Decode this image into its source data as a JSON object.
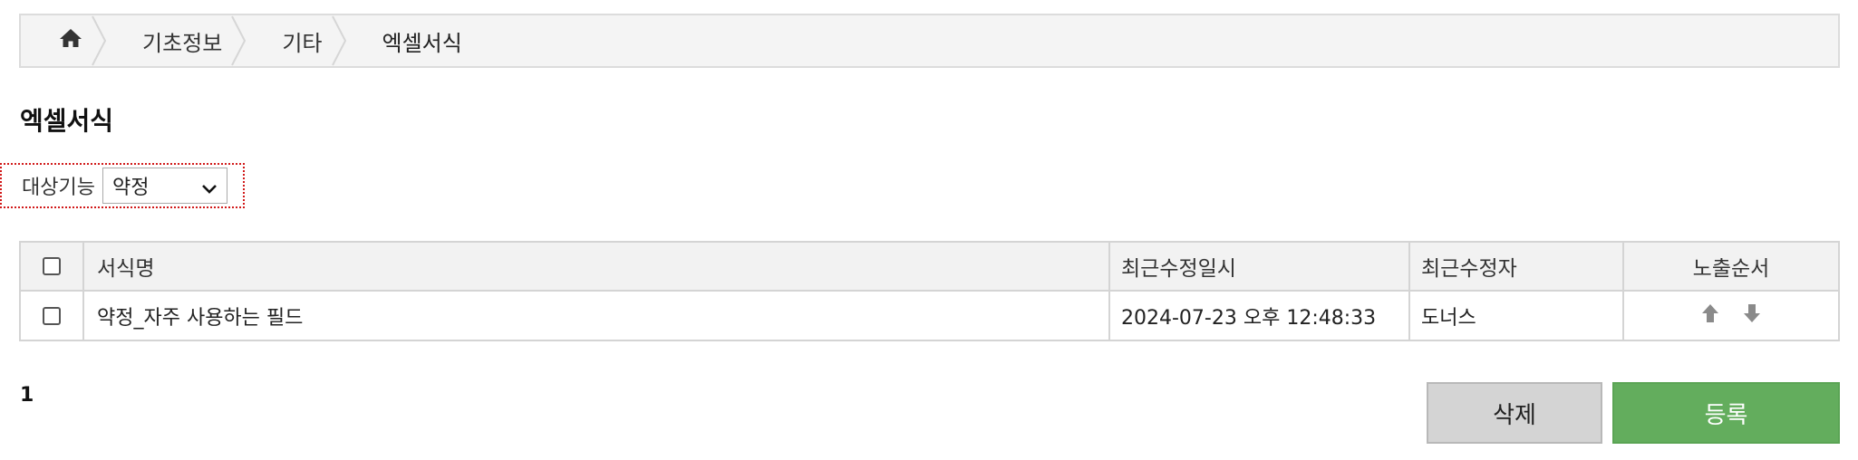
{
  "breadcrumb": {
    "home_icon": "home-icon",
    "items": [
      "기초정보",
      "기타",
      "엑셀서식"
    ]
  },
  "page_title": "엑셀서식",
  "filter": {
    "label": "대상기능",
    "selected": "약정"
  },
  "table": {
    "headers": [
      "서식명",
      "최근수정일시",
      "최근수정자",
      "노출순서"
    ],
    "rows": [
      {
        "checked": false,
        "name": "약정_자주 사용하는 필드",
        "modified_at": "2024-07-23 오후 12:48:33",
        "modified_by": "도너스"
      }
    ]
  },
  "pagination": {
    "current": "1"
  },
  "buttons": {
    "delete": "삭제",
    "register": "등록"
  },
  "colors": {
    "register_button": "#63ad5d",
    "delete_button": "#d4d4d4",
    "filter_highlight": "#d11a1a",
    "order_arrow": "#8a8a8a"
  }
}
